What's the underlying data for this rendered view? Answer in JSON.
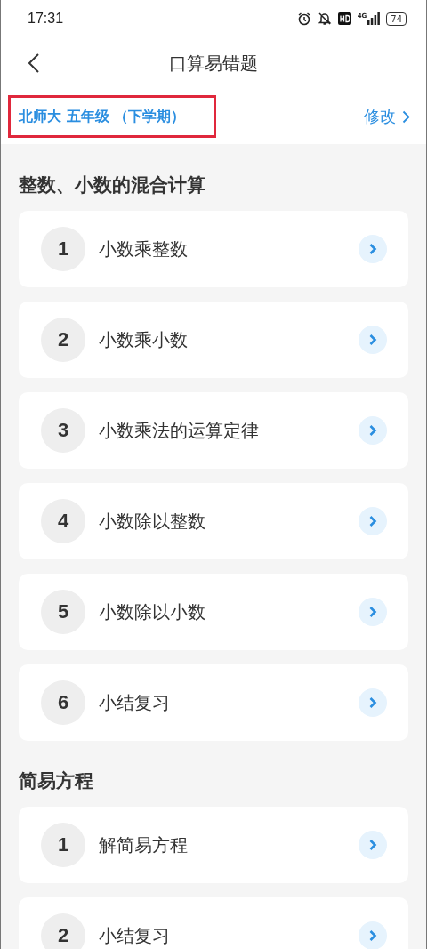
{
  "status_bar": {
    "time": "17:31",
    "battery": "74",
    "network": "4G"
  },
  "header": {
    "title": "口算易错题"
  },
  "subject_bar": {
    "label": "北师大 五年级 （下学期）",
    "action": "修改"
  },
  "sections": [
    {
      "title": "整数、小数的混合计算",
      "items": [
        {
          "number": "1",
          "label": "小数乘整数"
        },
        {
          "number": "2",
          "label": "小数乘小数"
        },
        {
          "number": "3",
          "label": "小数乘法的运算定律"
        },
        {
          "number": "4",
          "label": "小数除以整数"
        },
        {
          "number": "5",
          "label": "小数除以小数"
        },
        {
          "number": "6",
          "label": "小结复习"
        }
      ]
    },
    {
      "title": "简易方程",
      "items": [
        {
          "number": "1",
          "label": "解简易方程"
        },
        {
          "number": "2",
          "label": "小结复习"
        }
      ]
    }
  ]
}
